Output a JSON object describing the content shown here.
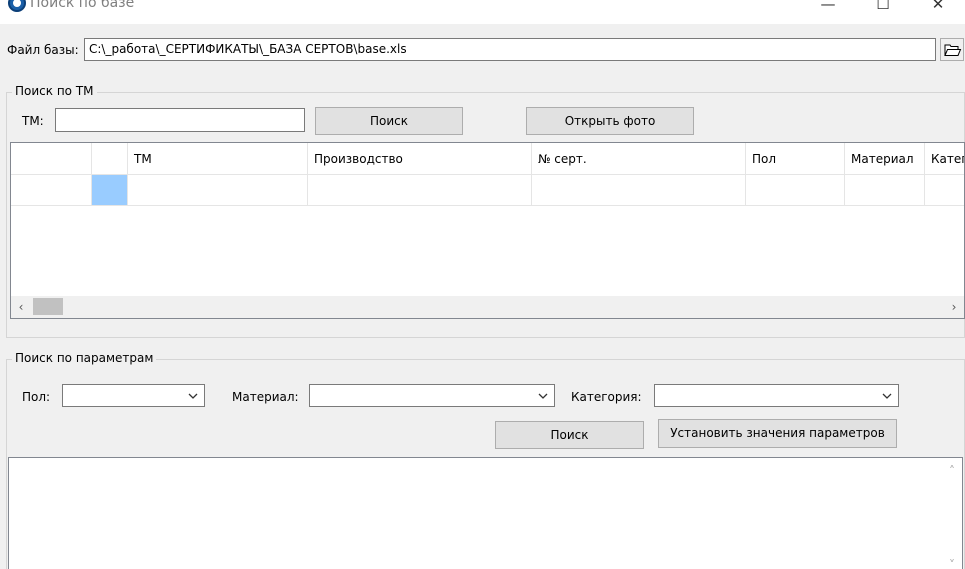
{
  "window": {
    "title": "Поиск по базе",
    "minimize_glyph": "—",
    "maximize_glyph": "☐",
    "close_glyph": "✕"
  },
  "file": {
    "label": "Файл базы:",
    "path": "C:\\_работа\\_СЕРТИФИКАТЫ\\_БАЗА СЕРТОВ\\base.xls",
    "open_icon": "folder-open-icon"
  },
  "tm_search": {
    "group_title": "Поиск по ТМ",
    "tm_label": "ТМ:",
    "tm_value": "",
    "search_button": "Поиск",
    "open_photo_button": "Открыть фото"
  },
  "grid": {
    "columns": [
      "",
      "",
      "ТМ",
      "Производство",
      "№ серт.",
      "Пол",
      "Материал",
      "Категория"
    ],
    "rows": [
      [
        "",
        "",
        "",
        "",
        "",
        "",
        "",
        ""
      ]
    ],
    "selected_cell_color": "#99ccff",
    "scroll_left": "‹",
    "scroll_right": "›"
  },
  "param_search": {
    "group_title": "Поиск по параметрам",
    "gender_label": "Пол:",
    "gender_value": "",
    "material_label": "Материал:",
    "material_value": "",
    "category_label": "Категория:",
    "category_value": "",
    "search_button": "Поиск",
    "set_params_button": "Установить значения параметров"
  },
  "result": {
    "text": "",
    "scroll_up": "˄",
    "scroll_down": "˅"
  },
  "colors": {
    "accent": "#1a5fa8",
    "selection": "#99ccff"
  }
}
